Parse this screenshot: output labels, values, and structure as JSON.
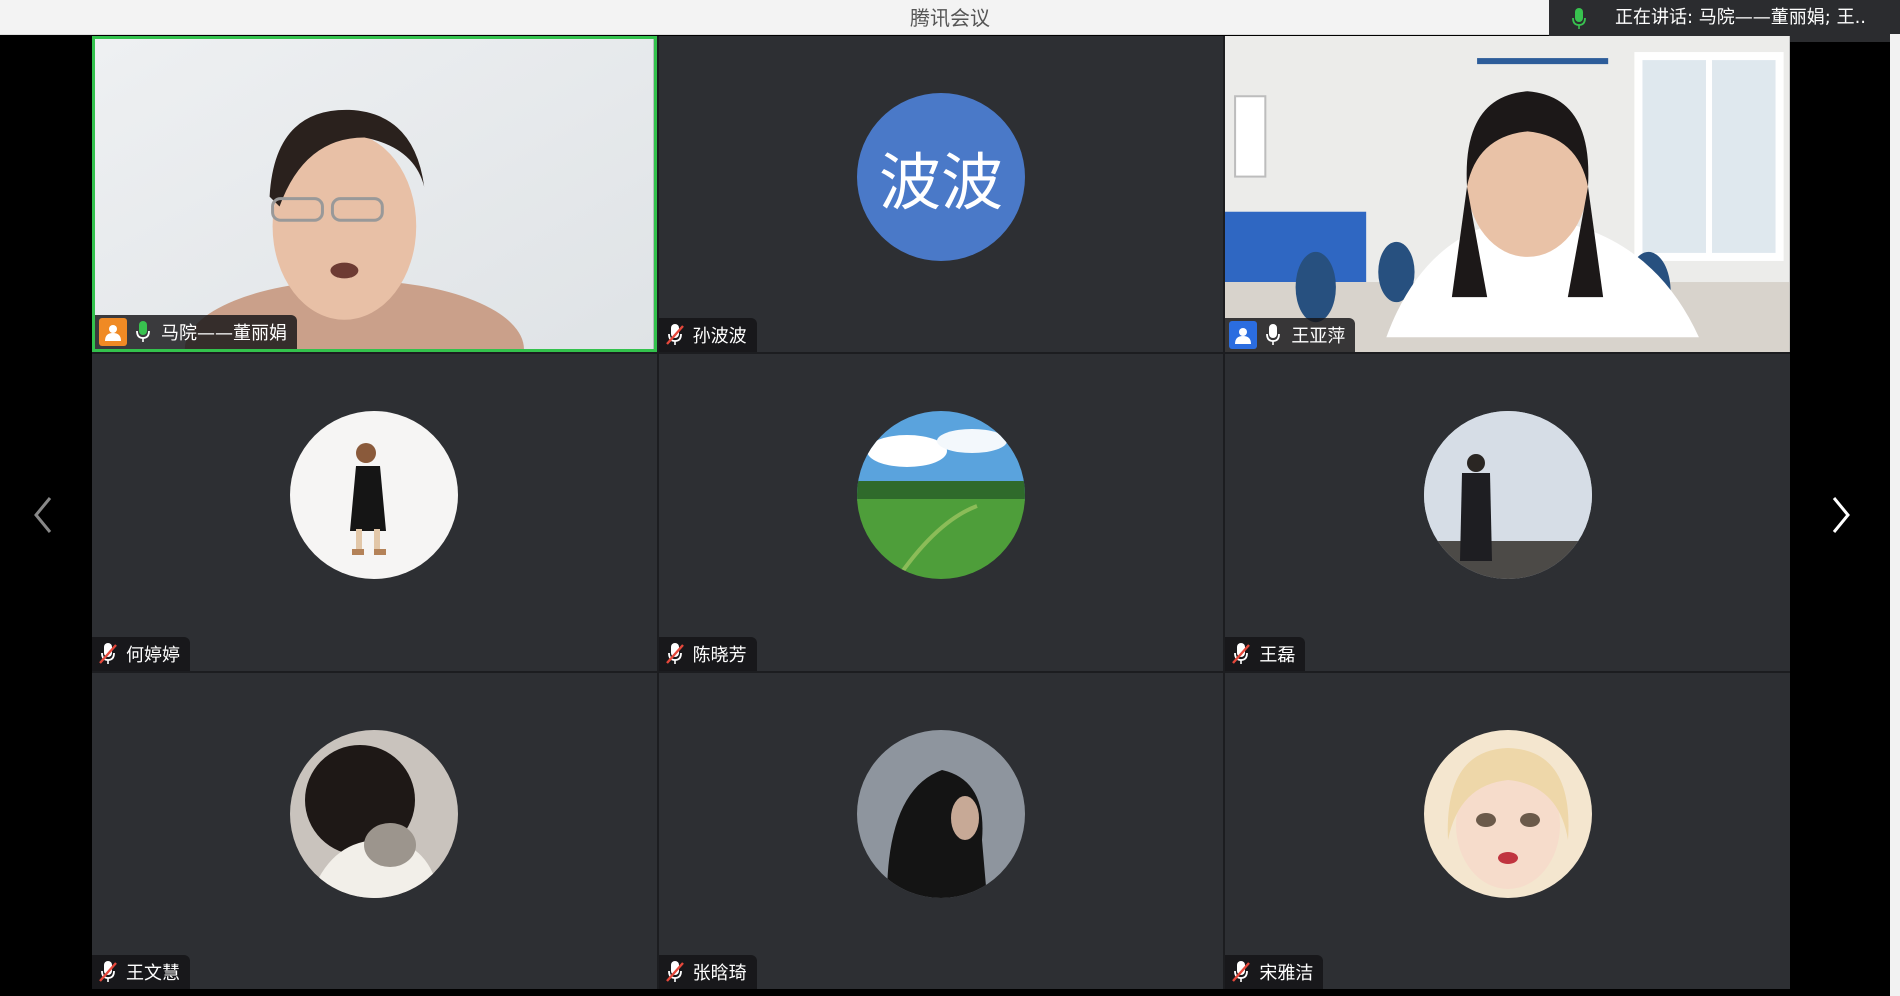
{
  "app": {
    "title": "腾讯会议"
  },
  "speaking_banner": {
    "text": "正在讲话:  马院——董丽娟; 王.."
  },
  "colors": {
    "active_border": "#33c24d",
    "tile_bg": "#2d2f33",
    "avatar_text_bg": "#4a79c8"
  },
  "participants": [
    {
      "name": "马院——董丽娟",
      "mic": "on",
      "video": true,
      "host_badge": "orange",
      "active": true
    },
    {
      "name": "孙波波",
      "mic": "muted",
      "video": false,
      "avatar_text": "波波"
    },
    {
      "name": "王亚萍",
      "mic": "on",
      "video": true,
      "host_badge": "blue"
    },
    {
      "name": "何婷婷",
      "mic": "muted",
      "video": false,
      "avatar_image": "walking-person-avatar"
    },
    {
      "name": "陈晓芳",
      "mic": "muted",
      "video": false,
      "avatar_image": "green-landscape-avatar"
    },
    {
      "name": "王磊",
      "mic": "muted",
      "video": false,
      "avatar_image": "man-by-sea-avatar"
    },
    {
      "name": "王文慧",
      "mic": "muted",
      "video": false,
      "avatar_image": "girl-with-cat-avatar"
    },
    {
      "name": "张晗琦",
      "mic": "muted",
      "video": false,
      "avatar_image": "girl-profile-avatar"
    },
    {
      "name": "宋雅洁",
      "mic": "muted",
      "video": false,
      "avatar_image": "anime-girl-avatar"
    }
  ],
  "navigation": {
    "prev": "chevron-left-icon",
    "next": "chevron-right-icon"
  }
}
